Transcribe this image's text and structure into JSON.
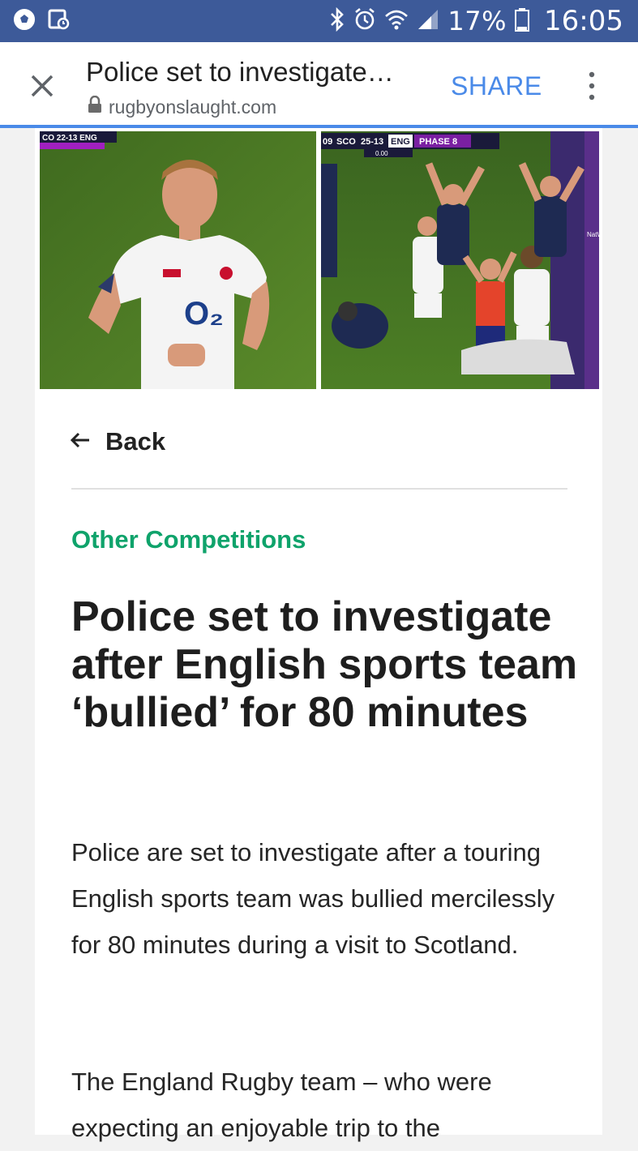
{
  "status_bar": {
    "battery": "17%",
    "time": "16:05",
    "background_color": "#3d5a99",
    "icons": [
      "soccer-ball-icon",
      "gallery-icon",
      "bluetooth-icon",
      "alarm-icon",
      "wifi-icon",
      "signal-icon",
      "battery-icon"
    ]
  },
  "toolbar": {
    "title": "Police set to investigate…",
    "url": "rugbyonslaught.com",
    "share_label": "SHARE",
    "accent_color": "#4a8ae8",
    "icons": [
      "close-icon",
      "lock-icon",
      "more-vert-icon"
    ]
  },
  "hero": {
    "left_scoreboard": "CO 22-13 ENG",
    "right_scoreboard": {
      "prefix": "09",
      "home": "SCO",
      "score": "25-13",
      "away": "ENG",
      "phase": "PHASE 8",
      "clock": "0.00"
    },
    "jersey_sponsor": "O₂",
    "board_text": "NatWest"
  },
  "article": {
    "back_label": "Back",
    "category": "Other Competitions",
    "category_color": "#0fa36b",
    "headline": "Police set to investigate after English sports team ‘bullied’ for 80 minutes",
    "paragraphs": [
      "Police are set to investigate after a touring English sports team was bullied mercilessly for 80 minutes during a visit to Scotland.",
      "The England Rugby team – who were expecting an enjoyable trip to the"
    ]
  }
}
